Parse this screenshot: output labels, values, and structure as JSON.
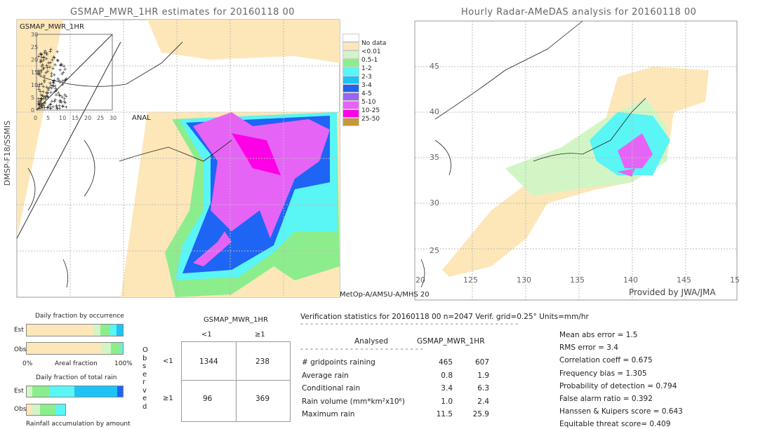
{
  "left_map": {
    "title": "GSMAP_MWR_1HR estimates for 20160118 00",
    "inset_title": "GSMAP_MWR_1HR",
    "inset_ticks": [
      "0",
      "5",
      "10",
      "15",
      "20",
      "25",
      "30"
    ],
    "y_label": "DMSP-F18/SSMIS",
    "anal_label": "ANAL",
    "bottom_label": "MetOp-A/AMSU-A/MHS 20"
  },
  "legend": {
    "items": [
      {
        "label": "No data",
        "color": "#ffffff"
      },
      {
        "label": "<0.01",
        "color": "#fde7b8"
      },
      {
        "label": "0.5-1",
        "color": "#d2f5c5"
      },
      {
        "label": "1-2",
        "color": "#8ced8c"
      },
      {
        "label": "2-3",
        "color": "#5af5f5"
      },
      {
        "label": "3-4",
        "color": "#1ec2f5"
      },
      {
        "label": "4-5",
        "color": "#1e64f5"
      },
      {
        "label": "5-10",
        "color": "#9a64f5"
      },
      {
        "label": "10-25",
        "color": "#e664f5"
      },
      {
        "label": "25-50",
        "color": "#ff00e6"
      },
      {
        "label": "",
        "color": "#c8963c"
      }
    ]
  },
  "right_map": {
    "title": "Hourly Radar-AMeDAS analysis for 20160118 00",
    "lat_labels": [
      "45",
      "40",
      "35",
      "30",
      "25",
      "20"
    ],
    "lon_labels": [
      "125",
      "130",
      "135",
      "140",
      "145",
      "15"
    ],
    "credit": "Provided by JWA/JMA"
  },
  "chart_data": [
    {
      "type": "bar",
      "title": "Daily fraction by occurrence",
      "xlabel": "Areal fraction",
      "tick_labels": [
        "0%",
        "100%"
      ],
      "categories": [
        "Est",
        "Obs"
      ],
      "series": [
        {
          "category": "Est",
          "segments": [
            0.69,
            0.07,
            0.1,
            0.07,
            0.07
          ]
        },
        {
          "category": "Obs",
          "segments": [
            0.77,
            0.1,
            0.1,
            0.03
          ]
        }
      ]
    },
    {
      "type": "bar",
      "title": "Daily fraction of total rain",
      "xlabel": "Rainfall accumulation by amount",
      "categories": [
        "Est",
        "Obs"
      ],
      "series": [
        {
          "category": "Est",
          "segments": [
            0.065,
            0.18,
            0.25,
            0.44,
            0.065
          ],
          "offset": 1
        },
        {
          "category": "Obs",
          "segments": [
            0.065,
            0.08,
            0.16,
            0.105
          ]
        }
      ]
    },
    {
      "type": "table",
      "title": "GSMAP_MWR_1HR",
      "row_header": "Observed",
      "columns": [
        "<1",
        "≥1"
      ],
      "rows": [
        "<1",
        "≥1"
      ],
      "values": [
        [
          "1344",
          "238"
        ],
        [
          "96",
          "369"
        ]
      ]
    }
  ],
  "stats": {
    "header": "Verification statistics for 20160118 00   n=2047   Verif. grid=0.25°   Units=mm/hr",
    "col_analysed": "Analysed",
    "col_gsmap": "GSMAP_MWR_1HR",
    "rows": [
      {
        "label": "# gridpoints raining",
        "a": "465",
        "g": "607"
      },
      {
        "label": "Average rain",
        "a": "0.8",
        "g": "1.9"
      },
      {
        "label": "Conditional rain",
        "a": "3.4",
        "g": "6.3"
      },
      {
        "label": "Rain volume (mm*km²x10⁶)",
        "a": "1.0",
        "g": "2.4"
      },
      {
        "label": "Maximum rain",
        "a": "11.5",
        "g": "25.9"
      }
    ],
    "scores": [
      "Mean abs error = 1.5",
      "RMS error = 3.4",
      "Correlation coeff = 0.675",
      "Frequency bias = 1.305",
      "Probability of detection = 0.794",
      "False alarm ratio = 0.392",
      "Hanssen & Kuipers score = 0.643",
      "Equitable threat score= 0.409"
    ]
  }
}
